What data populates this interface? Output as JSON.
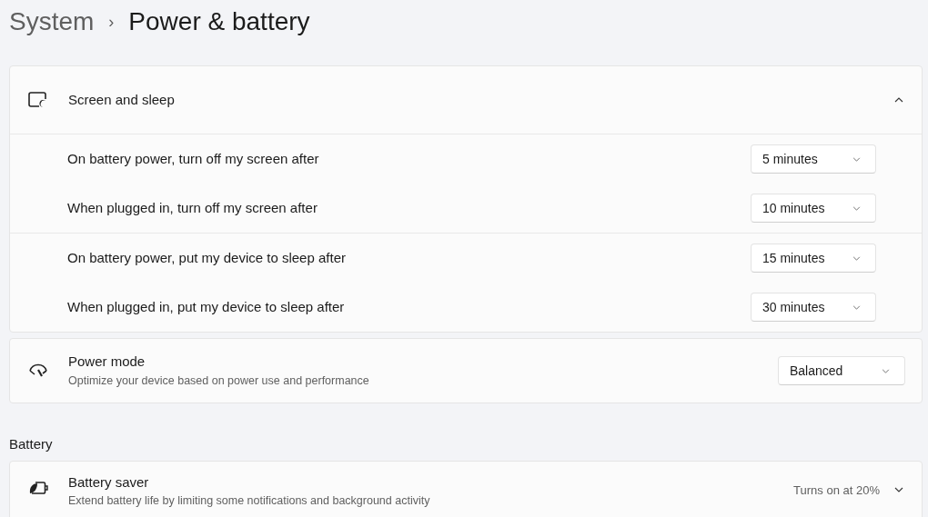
{
  "breadcrumb": {
    "parent": "System",
    "separator": "›",
    "current": "Power & battery"
  },
  "screen_sleep": {
    "title": "Screen and sleep",
    "expanded": true,
    "groups": [
      [
        {
          "label": "On battery power, turn off my screen after",
          "value": "5 minutes"
        },
        {
          "label": "When plugged in, turn off my screen after",
          "value": "10 minutes"
        }
      ],
      [
        {
          "label": "On battery power, put my device to sleep after",
          "value": "15 minutes"
        },
        {
          "label": "When plugged in, put my device to sleep after",
          "value": "30 minutes"
        }
      ]
    ]
  },
  "power_mode": {
    "title": "Power mode",
    "description": "Optimize your device based on power use and performance",
    "value": "Balanced"
  },
  "battery_section": {
    "heading": "Battery"
  },
  "battery_saver": {
    "title": "Battery saver",
    "description": "Extend battery life by limiting some notifications and background activity",
    "status": "Turns on at 20%",
    "expanded": false
  }
}
